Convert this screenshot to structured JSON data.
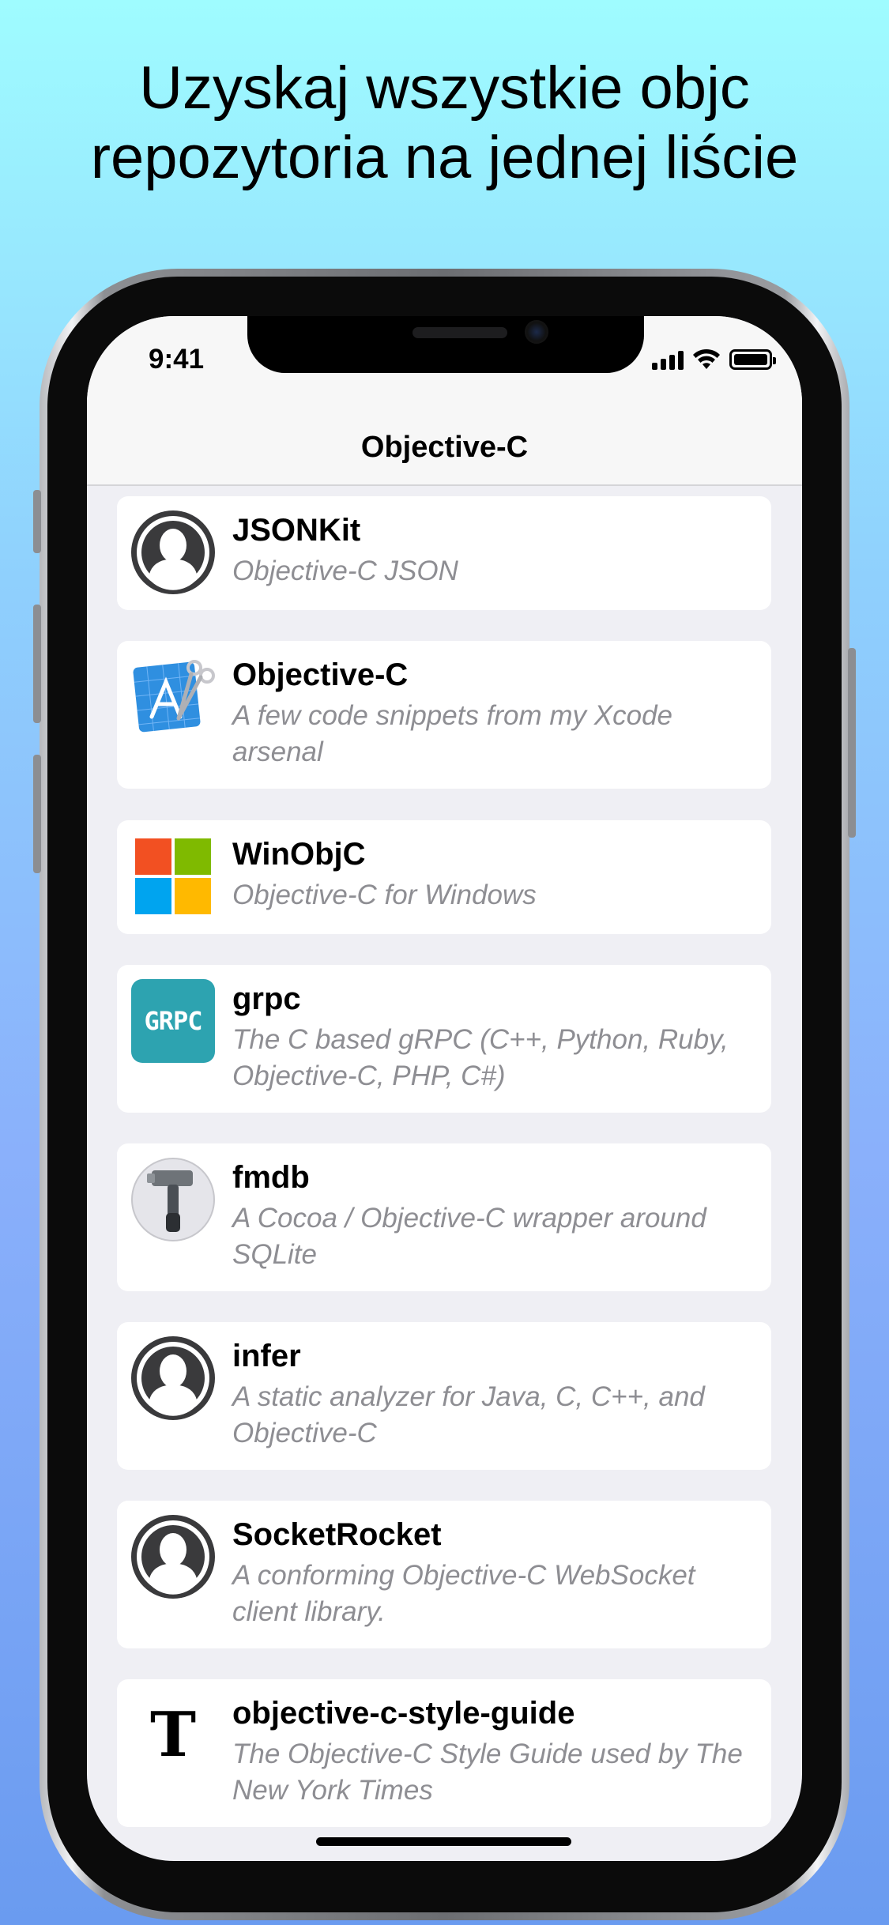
{
  "headline": {
    "line1": "Uzyskaj wszystkie objc",
    "line2": "repozytoria na jednej liście"
  },
  "status_bar": {
    "time": "9:41",
    "icons": [
      "cellular-signal-icon",
      "wifi-icon",
      "battery-icon"
    ]
  },
  "nav": {
    "title": "Objective-C"
  },
  "repos": [
    {
      "name": "JSONKit",
      "description": "Objective-C JSON",
      "icon": "default-avatar-icon"
    },
    {
      "name": "Objective-C",
      "description": "A few code snippets from my Xcode arsenal",
      "icon": "xcode-blueprint-icon"
    },
    {
      "name": "WinObjC",
      "description": "Objective-C for Windows",
      "icon": "windows-logo-icon"
    },
    {
      "name": "grpc",
      "description": "The C based gRPC (C++, Python, Ruby, Objective-C, PHP, C#)",
      "icon": "grpc-logo-icon",
      "icon_text": "GRPC"
    },
    {
      "name": "fmdb",
      "description": "A Cocoa / Objective-C wrapper around SQLite",
      "icon": "hammer-icon"
    },
    {
      "name": "infer",
      "description": "A static analyzer for Java, C, C++, and Objective-C",
      "icon": "default-avatar-icon"
    },
    {
      "name": "SocketRocket",
      "description": "A conforming Objective-C WebSocket client library.",
      "icon": "default-avatar-icon"
    },
    {
      "name": "objective-c-style-guide",
      "description": "The Objective-C Style Guide used by The New York Times",
      "icon": "nyt-logo-icon",
      "icon_text": "T"
    }
  ],
  "colors": {
    "background_top": "#9ffcff",
    "background_bottom": "#6a9bf0",
    "card_bg": "#ffffff",
    "list_bg": "#efeff4",
    "desc_text": "#8e8e93",
    "grpc_teal": "#2da3b0",
    "win_red": "#f25022",
    "win_green": "#7fba00",
    "win_blue": "#00a4ef",
    "win_yellow": "#ffb900"
  }
}
